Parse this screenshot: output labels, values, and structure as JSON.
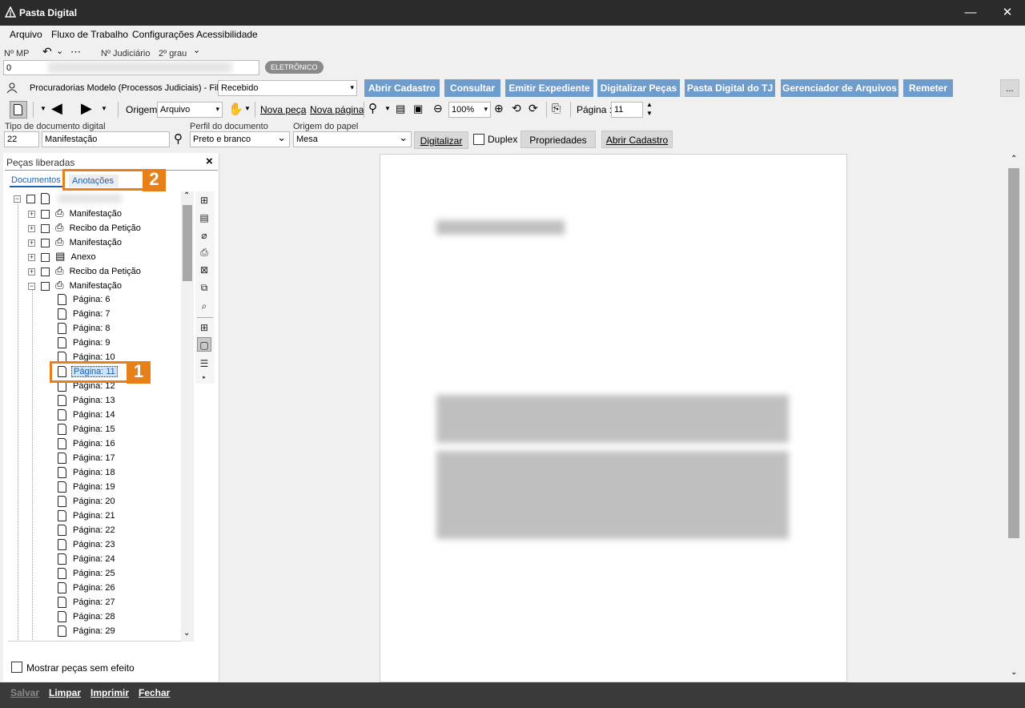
{
  "window": {
    "title": "Pasta Digital"
  },
  "menu": {
    "items": [
      "Arquivo",
      "Fluxo de Trabalho",
      "Configurações",
      "Acessibilidade"
    ]
  },
  "process": {
    "mp_label": "Nº MP",
    "judicial_label": "Nº Judiciário",
    "grade": "2º grau",
    "mp_value": "0",
    "badge": "ELETRÔNICO"
  },
  "queue": {
    "label": "Procuradorias Modelo (Processos Judiciais) - Fila",
    "selected": "Recebido"
  },
  "action_buttons": [
    "Abrir Cadastro",
    "Consultar",
    "Emitir Expediente",
    "Digitalizar Peças",
    "Pasta Digital do TJ",
    "Gerenciador de Arquivos",
    "Remeter"
  ],
  "more_button": "...",
  "toolbar": {
    "origem_label": "Origem",
    "origem_value": "Arquivo",
    "nova_peca": "Nova peça",
    "nova_pagina": "Nova página",
    "zoom": "100%",
    "pagina_label": "Página :",
    "pagina_value": "11"
  },
  "digitize": {
    "tipo_label": "Tipo de documento digital",
    "tipo_code": "22",
    "tipo_value": "Manifestação",
    "perfil_label": "Perfil do documento",
    "perfil_value": "Preto e branco",
    "origem_papel_label": "Origem do papel",
    "origem_papel_value": "Mesa",
    "digitalizar": "Digitalizar",
    "duplex": "Duplex",
    "propriedades": "Propriedades",
    "abrir_cadastro": "Abrir Cadastro"
  },
  "left_panel": {
    "title": "Peças liberadas",
    "close": "×",
    "tabs": [
      "Documentos",
      "Anotações"
    ],
    "documents": [
      "Manifestação",
      "Recibo da Petição",
      "Manifestação",
      "Anexo",
      "Recibo da Petição",
      "Manifestação"
    ],
    "pages": [
      "Página: 6",
      "Página: 7",
      "Página: 8",
      "Página: 9",
      "Página: 10",
      "Página: 11",
      "Página: 12",
      "Página: 13",
      "Página: 14",
      "Página: 15",
      "Página: 16",
      "Página: 17",
      "Página: 18",
      "Página: 19",
      "Página: 20",
      "Página: 21",
      "Página: 22",
      "Página: 23",
      "Página: 24",
      "Página: 25",
      "Página: 26",
      "Página: 27",
      "Página: 28",
      "Página: 29"
    ],
    "show_no_effect": "Mostrar peças sem efeito"
  },
  "callouts": {
    "one": "1",
    "two": "2"
  },
  "statusbar": {
    "items": [
      "Salvar",
      "Limpar",
      "Imprimir",
      "Fechar"
    ]
  }
}
